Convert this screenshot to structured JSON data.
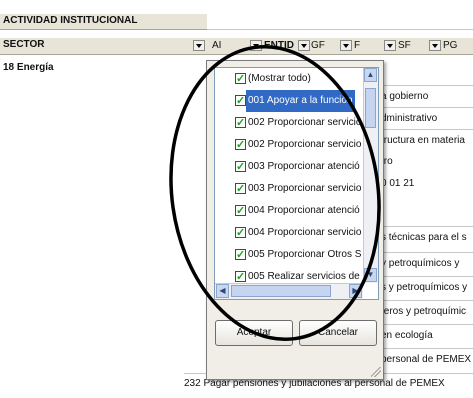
{
  "header": {
    "row1_label": "ACTIVIDAD INSTITUCIONAL",
    "row2_label": "SECTOR",
    "sector_value": "18 Energía"
  },
  "fields": [
    {
      "label": "AI"
    },
    {
      "label": "ENTID"
    },
    {
      "label": "GF"
    },
    {
      "label": "F"
    },
    {
      "label": "SF"
    },
    {
      "label": "PG"
    }
  ],
  "right_column": [
    "a gobierno",
    "dministrativo",
    "tructura en materia",
    "tro",
    "0 01       21",
    "",
    "s técnicas para el s",
    "y petroquímicos y",
    "s y petroquímicos y",
    "feros y petroquímic",
    "en ecología",
    "personal de PEMEX"
  ],
  "bottom_row": "232 Pagar pensiones y jubilaciones al personal de PEMEX",
  "filter_popup": {
    "items": [
      {
        "label": "(Mostrar todo)",
        "checked": true
      },
      {
        "label": "001 Apoyar a la función",
        "checked": true,
        "selected": true
      },
      {
        "label": "002 Proporcionar servicio",
        "checked": true
      },
      {
        "label": "002 Proporcionar servicio",
        "checked": true
      },
      {
        "label": "003 Proporcionar atenció",
        "checked": true
      },
      {
        "label": "003 Proporcionar servicio",
        "checked": true
      },
      {
        "label": "004 Proporcionar atenció",
        "checked": true
      },
      {
        "label": "004 Proporcionar servicio",
        "checked": true
      },
      {
        "label": "005 Proporcionar Otros S",
        "checked": true
      },
      {
        "label": "005 Realizar servicios de",
        "checked": true
      }
    ],
    "accept_label": "Aceptar",
    "cancel_label": "Cancelar"
  },
  "annotation_color": "#000000"
}
